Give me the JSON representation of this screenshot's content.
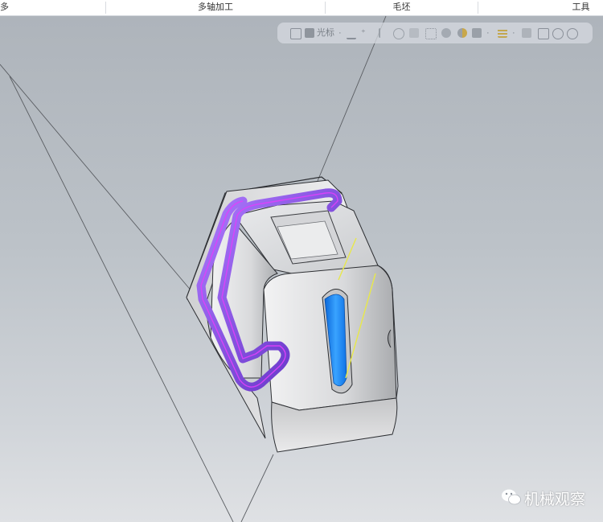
{
  "menu": {
    "partial_left": "多",
    "items": [
      "多轴加工",
      "毛坯",
      "工具"
    ]
  },
  "toolbar": {
    "cursor_label": "光标",
    "icons": [
      "save-icon",
      "part-view-icon",
      "separator",
      "coordinate-icon",
      "add-icon",
      "cursor-icon",
      "rotate-icon",
      "shade-icon",
      "wireframe-icon",
      "render-icon",
      "section-icon",
      "separator",
      "grid-icon",
      "view-icon",
      "transform-icon",
      "undo-icon"
    ]
  },
  "watermark": {
    "text": "机械观察"
  },
  "colors": {
    "toolpath_purple": "#8a2be2",
    "highlight_magenta": "#e040fb",
    "slot_blue": "#1e90ff",
    "guide_yellow": "#e8e84a"
  }
}
